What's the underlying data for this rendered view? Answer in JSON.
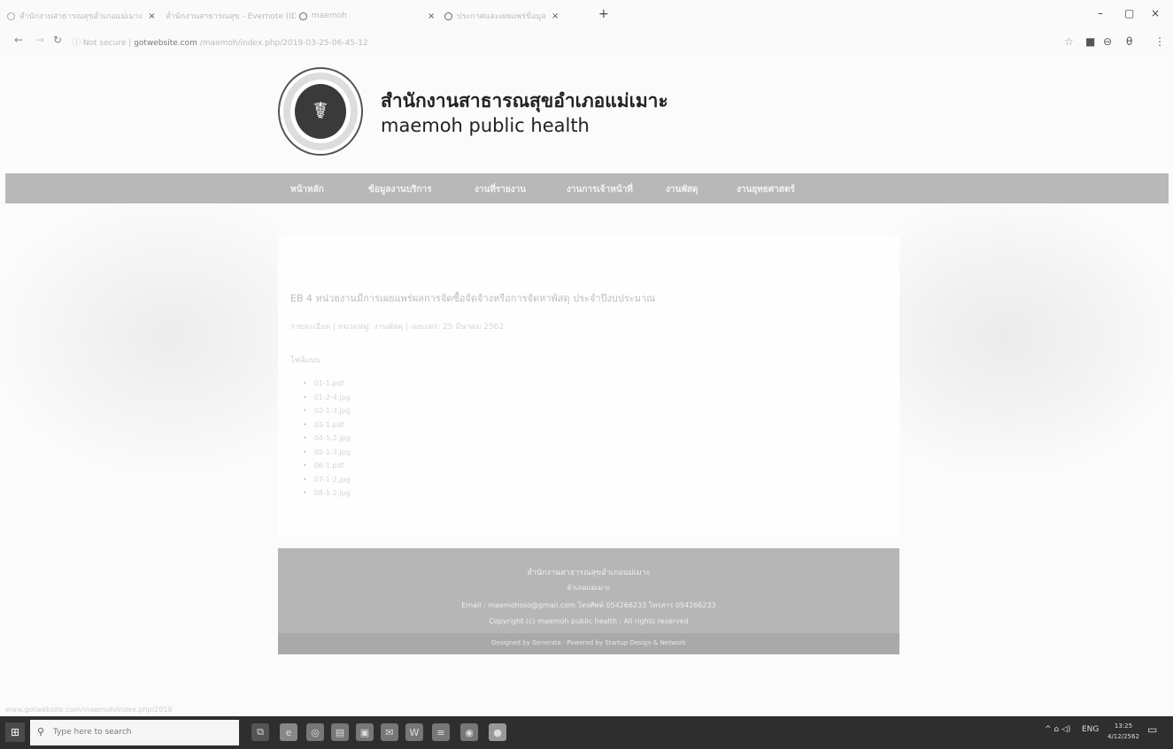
{
  "browser": {
    "tabs": [
      {
        "label": "สำนักงานสาธารณสุขอำเภอแม่เมาะ"
      },
      {
        "label": "สำนักงานสาธารณสุข - Evernote (ID)"
      },
      {
        "label": "maemoh"
      },
      {
        "label": "ประกาศและเผยแพร่ข้อมูล"
      }
    ],
    "new_tab": "+",
    "window_controls": [
      "–",
      "▢",
      "×"
    ],
    "url_prefix": "Not secure",
    "url_domain": "gotwebsite.com",
    "url_path": "/maemoh/index.php/2019-03-25-06-45-12"
  },
  "site": {
    "title_th": "สำนักงานสาธารณสุขอำเภอแม่เมาะ",
    "title_en": "maemoh public health",
    "nav": [
      "หน้าหลัก",
      "ข้อมูลงานบริการ",
      "งานที่รายงาน",
      "งานการเจ้าหน้าที่",
      "งานพัสดุ",
      "งานยุทธศาสตร์"
    ]
  },
  "content": {
    "post_title": "EB 4 หน่วยงานมีการเผยแพร่ผลการจัดซื้อจัดจ้างหรือการจัดหาพัสดุ ประจำปีงบประมาณ",
    "post_meta": "รายละเอียด  |  หมวดหมู่: งานพัสดุ  |  เผยแพร่: 25 มีนาคม 2562",
    "attachments_label": "ไฟล์แนบ",
    "attachments": [
      "01-1.pdf",
      "01-2-4.jpg",
      "02-1-3.jpg",
      "03-1.pdf",
      "04-1-2.jpg",
      "05-1-3.jpg",
      "06-1.pdf",
      "07-1-2.jpg",
      "08-1-2.jpg"
    ]
  },
  "footer": {
    "line1": "สำนักงานสาธารณสุขอำเภอแม่เมาะ",
    "line2": "อำเภอแม่เมาะ",
    "line3": "Email : maemohsso@gmail.com  โทรศัพท์ 054266233  โทรสาร 054266233",
    "line4": "Copyright (c) maemoh public health . All rights reserved",
    "bar": "Designed by Generate  ·  Powered by Startup Design & Network"
  },
  "statusbar": "www.gotwebsite.com/maemoh/index.php/2019",
  "taskbar": {
    "search_placeholder": "Type here to search",
    "tray_lang": "ENG",
    "time": "13:25",
    "date": "4/12/2562"
  },
  "colors": {
    "navbar": "#b8b8b8",
    "footer": "#b6b6b6",
    "taskbar": "#2e2e2e"
  }
}
